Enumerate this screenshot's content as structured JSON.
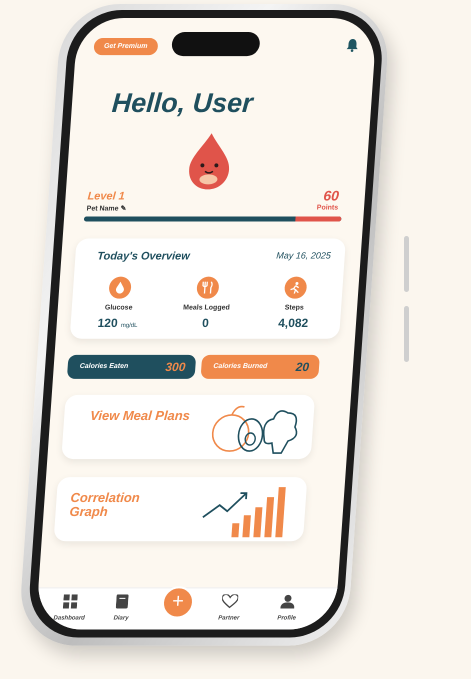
{
  "header": {
    "premium_label": "Get Premium",
    "bell_icon": "bell-icon",
    "greeting": "Hello, User"
  },
  "pet": {
    "level": "Level 1",
    "name": "Pet Name",
    "points_value": "60",
    "points_label": "Points",
    "progress": 0.18,
    "colors": {
      "pet": "#e0544a",
      "bar": "#1f4f5e",
      "fill": "#e0544a"
    }
  },
  "overview": {
    "title": "Today's Overview",
    "date": "May 16, 2025",
    "stats": [
      {
        "icon": "drop-icon",
        "label": "Glucose",
        "value": "120",
        "unit": "mg/dL"
      },
      {
        "icon": "utensils-icon",
        "label": "Meals Logged",
        "value": "0",
        "unit": ""
      },
      {
        "icon": "runner-icon",
        "label": "Steps",
        "value": "4,082",
        "unit": ""
      }
    ]
  },
  "calories": {
    "eaten_label": "Calories Eaten",
    "eaten_value": "300",
    "burned_label": "Calories Burned",
    "burned_value": "20"
  },
  "meal_plans": {
    "title": "View Meal Plans"
  },
  "correlation": {
    "title": "Correlation Graph"
  },
  "nav": {
    "items": [
      {
        "icon": "grid-icon",
        "label": "Dashboard"
      },
      {
        "icon": "book-icon",
        "label": "Diary"
      },
      {
        "icon": "heart-icon",
        "label": "Partner"
      },
      {
        "icon": "user-icon",
        "label": "Profile"
      }
    ],
    "add_symbol": "+"
  },
  "colors": {
    "accent": "#f0894a",
    "primary": "#1f4f5e",
    "background": "#fdf8f0"
  }
}
